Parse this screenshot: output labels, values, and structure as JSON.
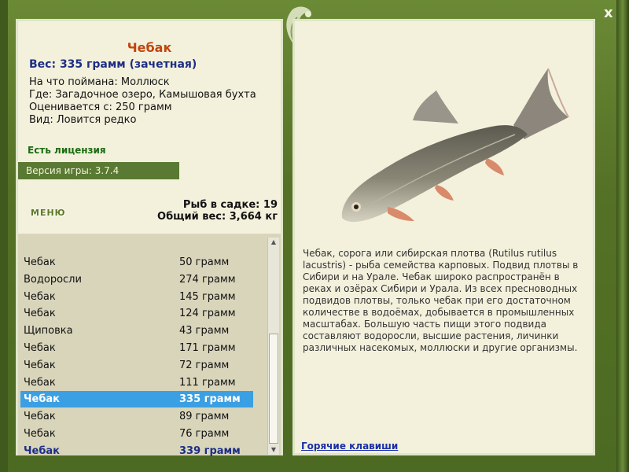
{
  "detail": {
    "fish_name": "Чебак",
    "weight_line": "Вес: 335 грамм (зачетная)",
    "caught_on": "На что поймана: Моллюск",
    "location": "Где: Загадочное озеро, Камышовая бухта",
    "valued_from": "Оценивается с: 250 грамм",
    "kind": "Вид: Ловится редко"
  },
  "license_text": "Есть лицензия",
  "version_text": "Версия игры: 3.7.4",
  "menu_label": "МЕНЮ",
  "stats": {
    "fish_count": "Рыб в садке: 19",
    "total_weight": "Общий вес: 3,664 кг"
  },
  "catch_list": [
    {
      "name": "Чебак",
      "weight": "50 грамм"
    },
    {
      "name": "Водоросли",
      "weight": "274 грамм"
    },
    {
      "name": "Чебак",
      "weight": "145 грамм"
    },
    {
      "name": "Чебак",
      "weight": "124 грамм"
    },
    {
      "name": "Щиповка",
      "weight": "43 грамм"
    },
    {
      "name": "Чебак",
      "weight": "171 грамм"
    },
    {
      "name": "Чебак",
      "weight": "72 грамм"
    },
    {
      "name": "Чебак",
      "weight": "111 грамм"
    },
    {
      "name": "Чебак",
      "weight": "335 грамм"
    },
    {
      "name": "Чебак",
      "weight": "89 грамм"
    },
    {
      "name": "Чебак",
      "weight": "76 грамм"
    },
    {
      "name": "Чебак",
      "weight": "339 грамм"
    }
  ],
  "selected_index": 8,
  "description": "Чебак, сорога или сибирская плотва (Rutilus rutilus lacustris) - рыба семейства карповых. Подвид плотвы в Сибири и на Урале. Чебак широко распространён в реках и озёрах Сибири и Урала. Из всех пресноводных подвидов плотвы, только чебак при его достаточном количестве в водоёмах, добывается в промышленных масштабах. Большую часть пищи этого подвида составляют водоросли, высшие растения, личинки различных насекомых, моллюски и другие организмы.",
  "hotkeys_label": "Горячие клавиши",
  "close_label": "x",
  "icons": {
    "close": "close-icon",
    "ornament": "leaf-ornament-icon",
    "scroll_up": "scroll-up-icon",
    "scroll_down": "scroll-down-icon"
  },
  "colors": {
    "title": "#c0450e",
    "weight": "#1e2e86",
    "license": "#1c6b12",
    "selected": "#3b9fe3",
    "version_bar": "#5a7a33",
    "link": "#1b2fa8"
  }
}
